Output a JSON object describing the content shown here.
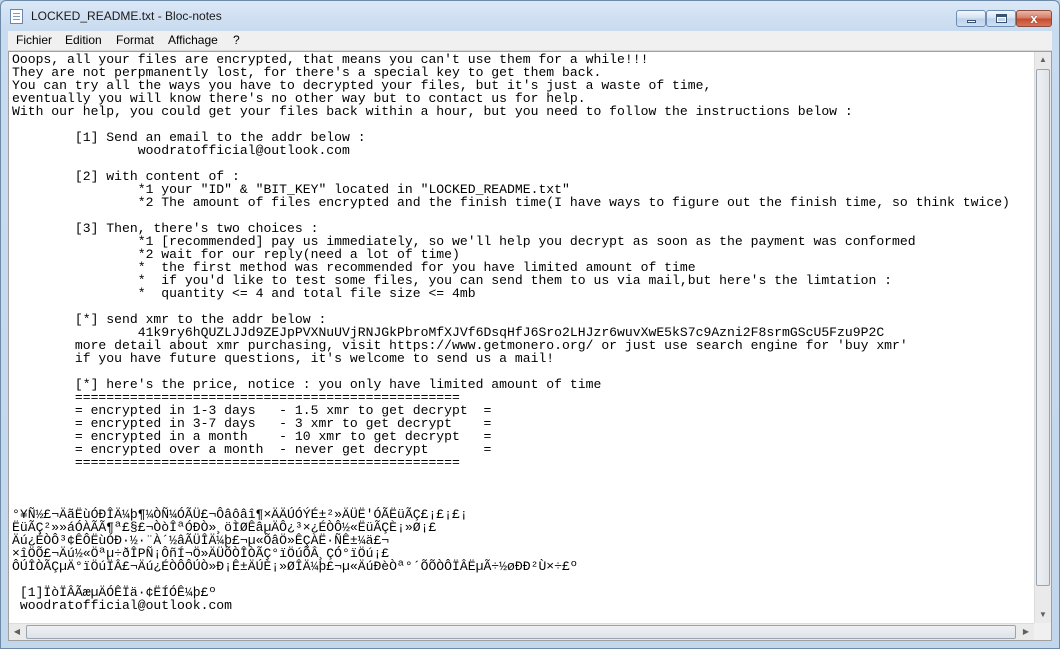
{
  "window": {
    "title": "LOCKED_README.txt - Bloc-notes",
    "close_label": "x"
  },
  "menu": {
    "items": [
      "Fichier",
      "Edition",
      "Format",
      "Affichage",
      "?"
    ]
  },
  "document": {
    "lines": [
      "Ooops, all your files are encrypted, that means you can't use them for a while!!!",
      "They are not perpmanently lost, for there's a special key to get them back.",
      "You can try all the ways you have to decrypted your files, but it's just a waste of time,",
      "eventually you will know there's no other way but to contact us for help.",
      "With our help, you could get your files back within a hour, but you need to follow the instructions below :",
      "",
      "        [1] Send an email to the addr below :",
      "                woodratofficial@outlook.com",
      "",
      "        [2] with content of :",
      "                *1 your \"ID\" & \"BIT_KEY\" located in \"LOCKED_README.txt\"",
      "                *2 The amount of files encrypted and the finish time(I have ways to figure out the finish time, so think twice)",
      "",
      "        [3] Then, there's two choices :",
      "                *1 [recommended] pay us immediately, so we'll help you decrypt as soon as the payment was conformed",
      "                *2 wait for our reply(need a lot of time)",
      "                *  the first method was recommended for you have limited amount of time",
      "                *  if you'd like to test some files, you can send them to us via mail,but here's the limtation :",
      "                *  quantity <= 4 and total file size <= 4mb",
      "",
      "        [*] send xmr to the addr below :",
      "                41k9ry6hQUZLJJd9ZEJpPVXNuUVjRNJGkPbroMfXJVf6DsqHfJ6Sro2LHJzr6wuvXwE5kS7c9Azni2F8srmGScU5Fzu9P2C",
      "        more detail about xmr purchasing, visit https://www.getmonero.org/ or just use search engine for 'buy xmr'",
      "        if you have future questions, it's welcome to send us a mail!",
      "",
      "        [*] here's the price, notice : you only have limited amount of time",
      "        =================================================",
      "        = encrypted in 1-3 days   - 1.5 xmr to get decrypt  =",
      "        = encrypted in 3-7 days   - 3 xmr to get decrypt    =",
      "        = encrypted in a month    - 10 xmr to get decrypt   =",
      "        = encrypted over a month  - never get decrypt       =",
      "        =================================================",
      "",
      "",
      "",
      "°¥Ñ½£¬ÄãËùÓÐÎÄ¼þ¶¼ÒÑ¼ÓÃÜ£¬Ôâôâî¶×ÄÄÚÓÝÉ±²»ÄÜË'ÓÃËüÃÇ£¡£¡£¡",
      "ËüÃÇ²»»áÓÀÃÃ¶ª£§£¬ÒòÎªÓÐÒ»¸öÌØÊâµÄÔ¿³×¿ÉÒÔ½«ËüÃÇÈ¡»Ø¡£",
      "Äú¿ÉÒÔ³¢ÊÔËùÓÐ·½·¨À´½âÃÜÎÄ¼þ£¬µ«ÕâÖ»ÊÇÀË·ÑÊ±¼ä£¬",
      "×îÖÕ£¬Äú½«Öªµ÷ðÎPÑ¡ÔñÍ¬Ö»ÄÜÕÒÎÒÃÇ°ïÖúÕÂ¸ÇÓ°ïÖú¡£",
      "ÔÚÎÒÃÇµÄ°ïÖúÏÂ£¬Äú¿ÉÒÔÔÚÒ»Ð¡Ê±ÄÚÈ¡»ØÎÄ¼þ£¬µ«ÄúÐèÒª°´ÕÕÒÔÏÂËµÃ÷½øÐÐ²Ù×÷£º",
      "",
      " [1]ÏòÏÂÃæµÄÓÊÏä·¢ËÍÓÊ¼þ£º",
      " woodratofficial@outlook.com"
    ]
  }
}
